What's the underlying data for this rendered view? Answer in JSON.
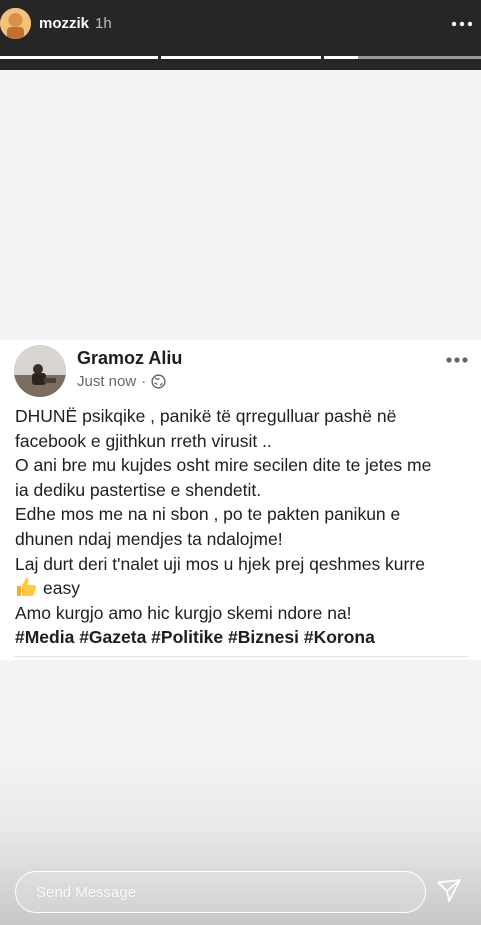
{
  "story": {
    "username": "mozzik",
    "time": "1h",
    "progress_segments": [
      {
        "state": "done"
      },
      {
        "state": "done"
      },
      {
        "state": "done"
      },
      {
        "state": "done"
      }
    ],
    "message_placeholder": "Send Message"
  },
  "post": {
    "author": "Gramoz Aliu",
    "timestamp": "Just now",
    "separator": "·",
    "lines": [
      "DHUNË psikqike , panikë të qrregulluar pashë në",
      "facebook e gjithkun rreth virusit ..",
      "O ani bre mu kujdes osht mire secilen dite te jetes me",
      "ia dediku pastertise e shendetit.",
      "Edhe mos me na ni sbon , po te pakten panikun e",
      "dhunen ndaj mendjes ta ndalojme!",
      "Laj durt deri t'nalet uji mos u hjek prej qeshmes kurre"
    ],
    "emoji_line": "easy",
    "last_line": "Amo kurgjo amo hic kurgjo skemi ndore na!",
    "hashtags": "#Media #Gazeta #Politike #Biznesi #Korona"
  }
}
